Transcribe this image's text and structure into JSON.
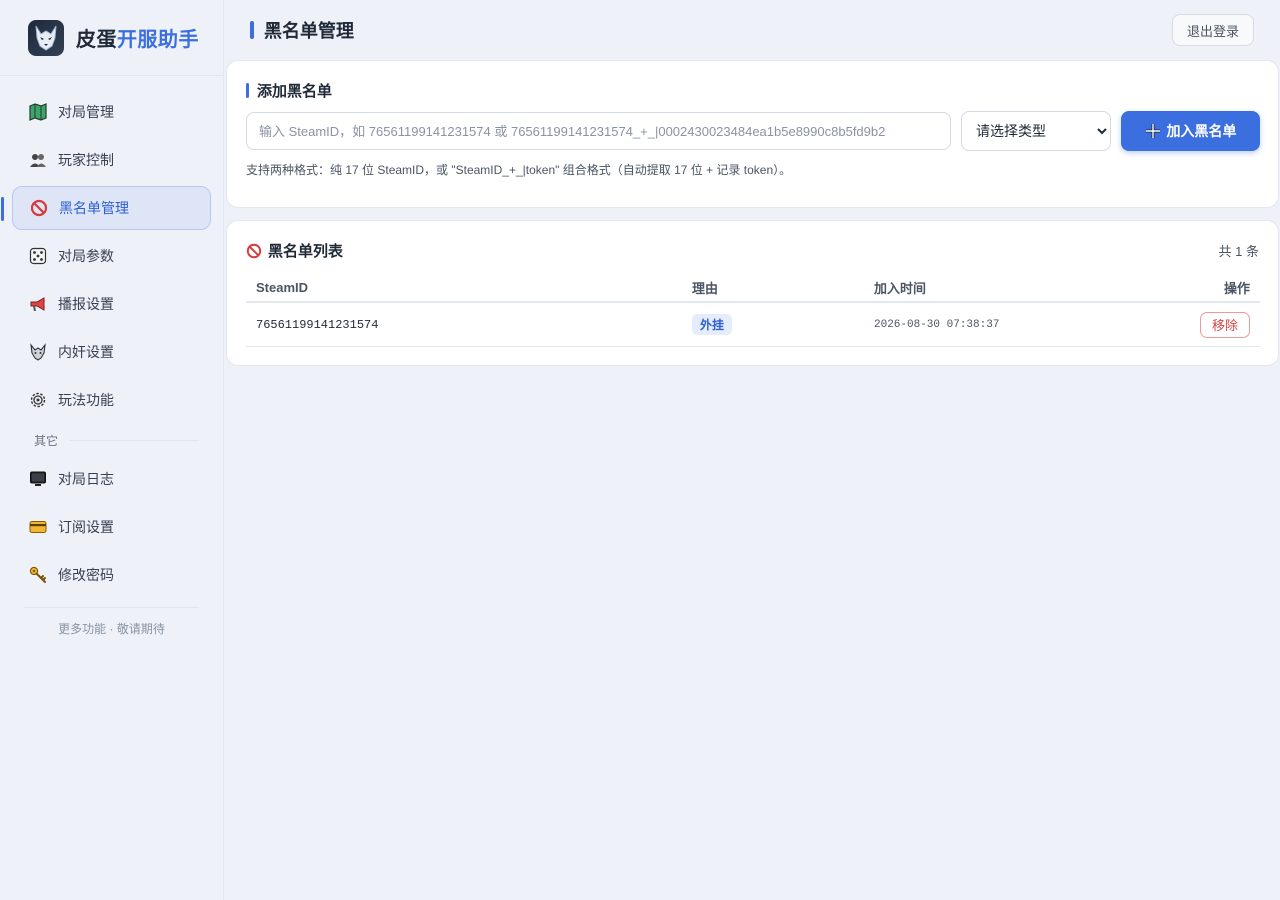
{
  "brand": {
    "name_part1": "皮蛋",
    "name_part2": "开服助手",
    "accent_color": "#3b6fe0"
  },
  "sidebar": {
    "items": [
      {
        "label": "对局管理",
        "icon": "map-icon"
      },
      {
        "label": "玩家控制",
        "icon": "players-icon"
      },
      {
        "label": "黑名单管理",
        "icon": "prohibited-icon",
        "active": true
      },
      {
        "label": "对局参数",
        "icon": "dice-icon"
      },
      {
        "label": "播报设置",
        "icon": "megaphone-icon"
      },
      {
        "label": "内奸设置",
        "icon": "wolf-icon"
      },
      {
        "label": "玩法功能",
        "icon": "gear-icon"
      }
    ],
    "section_label": "其它",
    "other_items": [
      {
        "label": "对局日志",
        "icon": "monitor-icon"
      },
      {
        "label": "订阅设置",
        "icon": "credit-card-icon"
      },
      {
        "label": "修改密码",
        "icon": "key-icon"
      }
    ],
    "footer": "更多功能 · 敬请期待"
  },
  "header": {
    "title": "黑名单管理",
    "logout_label": "退出登录"
  },
  "add_card": {
    "title": "添加黑名单",
    "input_value": "",
    "input_placeholder": "输入 SteamID，如 76561199141231574 或 76561199141231574_+_|0002430023484ea1b5e8990c8b5fd9b2",
    "select_value": "请选择类型",
    "button_label": "加入黑名单",
    "hint": "支持两种格式：纯 17 位 SteamID，或 \"SteamID_+_|token\" 组合格式（自动提取 17 位 + 记录 token）。"
  },
  "list_card": {
    "title": "黑名单列表",
    "count_label": "共 1 条",
    "columns": {
      "id": "SteamID",
      "reason": "理由",
      "time": "加入时间",
      "op": "操作"
    },
    "rows": [
      {
        "steam_id": "76561199141231574",
        "reason": "外挂",
        "time": "2026-08-30 07:38:37",
        "action": "移除"
      }
    ]
  }
}
